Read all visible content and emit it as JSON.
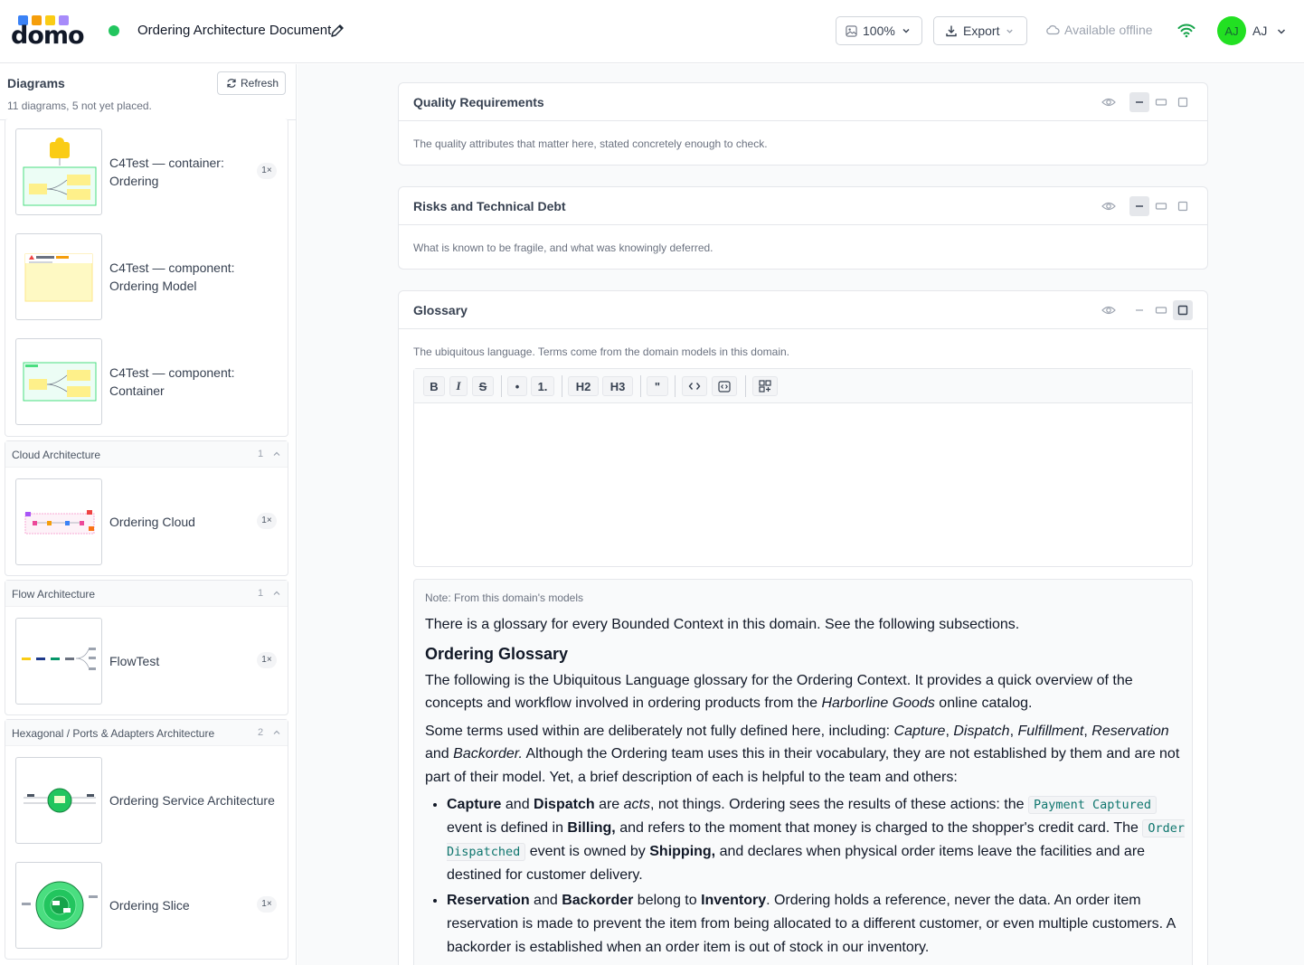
{
  "app": {
    "logo_text": "domo",
    "logo_colors": [
      "#3b82f6",
      "#f59e0b",
      "#facc15",
      "#a78bfa"
    ],
    "document_title": "Ordering Architecture Document",
    "status_color": "#22c55e"
  },
  "header": {
    "zoom_label": "100%",
    "export_label": "Export",
    "offline_label": "Available offline",
    "user_initials_avatar": "AJ",
    "user_initials": "AJ",
    "avatar_color": "#22e022"
  },
  "sidebar": {
    "title": "Diagrams",
    "refresh_label": "Refresh",
    "subtitle": "11 diagrams, 5 not yet placed.",
    "groups": [
      {
        "name": "",
        "items": [
          {
            "label": "C4Test — container: Ordering",
            "badge": "1×"
          },
          {
            "label": "C4Test — component: Ordering Model",
            "badge": ""
          },
          {
            "label": "C4Test — component: Container",
            "badge": ""
          }
        ]
      },
      {
        "name": "Cloud Architecture",
        "count": "1",
        "items": [
          {
            "label": "Ordering Cloud",
            "badge": "1×"
          }
        ]
      },
      {
        "name": "Flow Architecture",
        "count": "1",
        "items": [
          {
            "label": "FlowTest",
            "badge": "1×"
          }
        ]
      },
      {
        "name": "Hexagonal / Ports & Adapters Architecture",
        "count": "2",
        "items": [
          {
            "label": "Ordering Service Architecture",
            "badge": ""
          },
          {
            "label": "Ordering Slice",
            "badge": "1×"
          }
        ]
      }
    ]
  },
  "sections": [
    {
      "title": "Quality Requirements",
      "description": "The quality attributes that matter here, stated concretely enough to check.",
      "view_mode": "minimized"
    },
    {
      "title": "Risks and Technical Debt",
      "description": "What is known to be fragile, and what was knowingly deferred.",
      "view_mode": "minimized"
    },
    {
      "title": "Glossary",
      "description": "The ubiquitous language. Terms come from the domain models in this domain.",
      "view_mode": "expanded"
    }
  ],
  "toolbar": {
    "bold": "B",
    "italic": "I",
    "strike": "S",
    "bullet": "•",
    "ordered": "1.",
    "h2": "H2",
    "h3": "H3",
    "quote": "\""
  },
  "note": {
    "label": "Note: From this domain's models",
    "intro": "There is a glossary for every Bounded Context in this domain. See the following subsections.",
    "heading": "Ordering Glossary",
    "p1_a": "The following is the Ubiquitous Language glossary for the Ordering Context. It provides a quick overview of the concepts and workflow involved in ordering products from the ",
    "p1_em": "Harborline Goods",
    "p1_b": " online catalog.",
    "p2_a": "Some terms used within are deliberately not fully defined here, including: ",
    "p2_t1": "Capture",
    "p2_sep1": ", ",
    "p2_t2": "Dispatch",
    "p2_sep2": ", ",
    "p2_t3": "Fulfillment",
    "p2_sep3": ", ",
    "p2_t4": "Reservation",
    "p2_and": " and ",
    "p2_t5": "Backorder.",
    "p2_b": " Although the Ordering team uses this in their vocabulary, they are not established by them and are not part of their model. Yet, a brief description of each is helpful to the team and others:",
    "li1_s1": "Capture",
    "li1_and": " and ",
    "li1_s2": "Dispatch",
    "li1_are": " are ",
    "li1_em": "acts",
    "li1_a": ", not things. Ordering sees the results of these actions: the ",
    "li1_code1": "Payment Captured",
    "li1_b": " event is defined in ",
    "li1_s3": "Billing,",
    "li1_c": " and refers to the moment that money is charged to the shopper's credit card. The ",
    "li1_code2": "Order Dispatched",
    "li1_d": " event is owned by ",
    "li1_s4": "Shipping,",
    "li1_e": " and declares when physical order items leave the facilities and are destined for customer delivery.",
    "li2_s1": "Reservation",
    "li2_and": " and ",
    "li2_s2": "Backorder",
    "li2_a": " belong to ",
    "li2_s3": "Inventory",
    "li2_b": ". Ordering holds a reference, never the data. An order item reservation is made to prevent the item from being allocated to a different customer, or even multiple customers. A backorder is established when an order item is out of stock in our inventory."
  }
}
